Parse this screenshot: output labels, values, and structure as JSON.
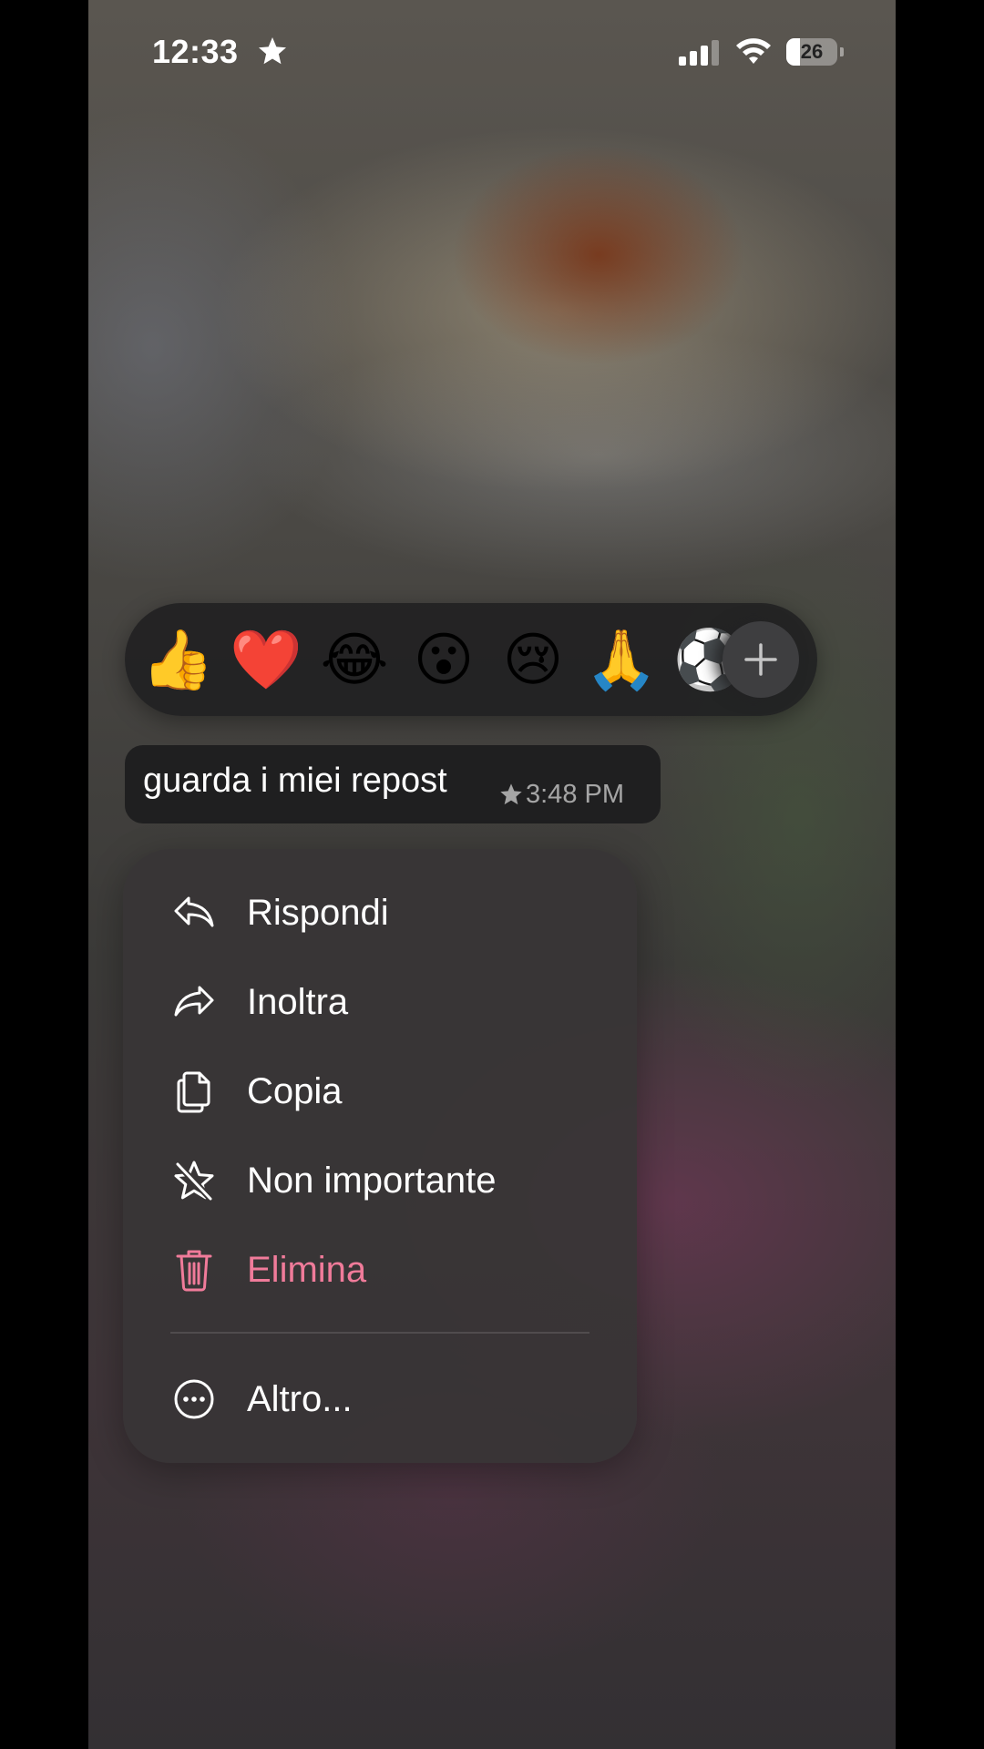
{
  "status_bar": {
    "time": "12:33",
    "battery": "26",
    "battery_level": 0.26
  },
  "reactions": {
    "items": [
      "👍",
      "❤️",
      "😂",
      "😮",
      "😢",
      "🙏",
      "⚽"
    ],
    "more_icon": "plus-icon"
  },
  "message": {
    "text": "guarda i miei repost",
    "time": "3:48 PM",
    "starred": true
  },
  "menu": {
    "items": [
      {
        "label": "Rispondi",
        "icon": "reply-icon"
      },
      {
        "label": "Inoltra",
        "icon": "forward-icon"
      },
      {
        "label": "Copia",
        "icon": "copy-icon"
      },
      {
        "label": "Non importante",
        "icon": "unstar-icon"
      },
      {
        "label": "Elimina",
        "icon": "trash-icon",
        "color": "#f07b9a"
      },
      {
        "label": "Altro...",
        "icon": "more-icon"
      }
    ]
  },
  "colors": {
    "danger": "#f07b9a"
  }
}
